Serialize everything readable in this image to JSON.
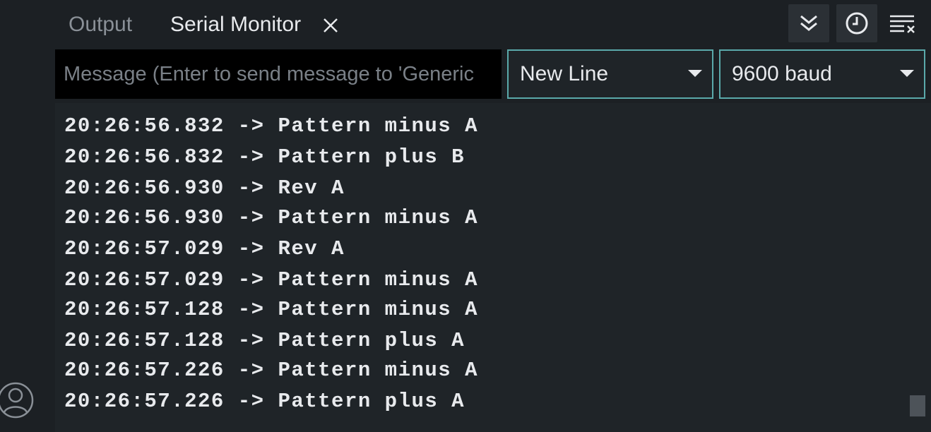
{
  "tabs": {
    "output_label": "Output",
    "serial_label": "Serial Monitor"
  },
  "toolbar": {
    "autoscroll_icon": "double-chevron-down-icon",
    "timestamp_icon": "clock-icon",
    "clear_icon": "clear-output-icon"
  },
  "input": {
    "placeholder": "Message (Enter to send message to 'Generic"
  },
  "line_ending": {
    "selected": "New Line"
  },
  "baud": {
    "selected": "9600 baud"
  },
  "log": [
    "20:26:56.832 -> Pattern minus A",
    "20:26:56.832 -> Pattern plus B",
    "20:26:56.930 -> Rev A",
    "20:26:56.930 -> Pattern minus A",
    "20:26:57.029 -> Rev A",
    "20:26:57.029 -> Pattern minus A",
    "20:26:57.128 -> Pattern minus A",
    "20:26:57.128 -> Pattern plus A",
    "20:26:57.226 -> Pattern minus A",
    "20:26:57.226 -> Pattern plus A"
  ],
  "colors": {
    "background": "#1c2024",
    "accent_border": "#5aa9aa",
    "text": "#e8eaed"
  }
}
